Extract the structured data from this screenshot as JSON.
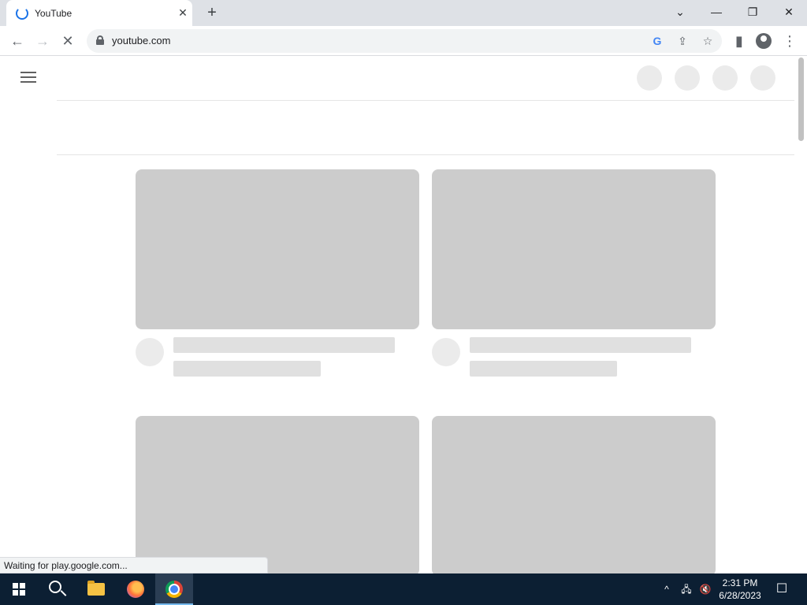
{
  "browser": {
    "tab": {
      "title": "YouTube",
      "close_glyph": "✕"
    },
    "new_tab_glyph": "+",
    "window_controls": {
      "tab_search": "⌄",
      "minimize": "—",
      "restore": "❐",
      "close": "✕"
    },
    "nav": {
      "back": "←",
      "forward": "→",
      "stop": "✕"
    },
    "address": {
      "url": "youtube.com"
    },
    "omnibox_icons": {
      "google": "G",
      "share": "⇪",
      "bookmark": "☆"
    },
    "toolbar_icons": {
      "side_panel": "▮",
      "menu": "⋮"
    }
  },
  "page": {
    "status_text": "Waiting for play.google.com..."
  },
  "taskbar": {
    "tray": {
      "chevron": "^",
      "network": "🖧",
      "volume": "🔇",
      "notifications": "☐"
    },
    "clock": {
      "time": "2:31 PM",
      "date": "6/28/2023"
    }
  }
}
